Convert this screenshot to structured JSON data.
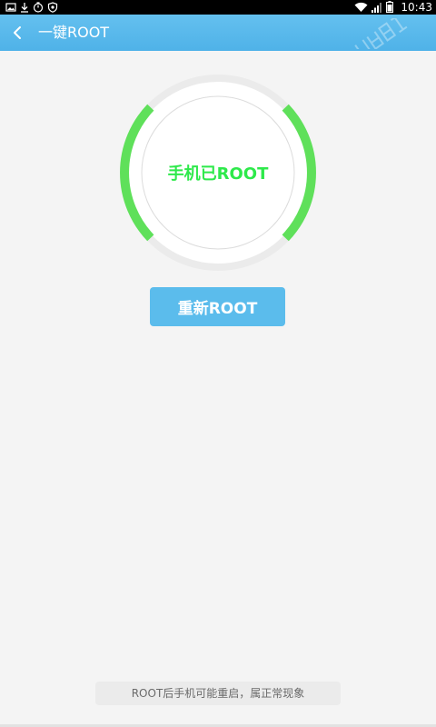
{
  "status_bar": {
    "time": "10:43",
    "left_icons": [
      "image-icon",
      "download-icon",
      "timer-icon",
      "shield-icon"
    ],
    "right_icons": [
      "wifi-icon",
      "signal-icon",
      "battery-icon"
    ]
  },
  "header": {
    "title": "一键ROOT",
    "back_icon": "chevron-left-icon",
    "watermark_icon": "watermark-logo-icon"
  },
  "status": {
    "text": "手机已ROOT",
    "text_color": "#2ee94b",
    "arc_color": "#5fe05a",
    "ring_color": "#ebebeb"
  },
  "actions": {
    "reroot_label": "重新ROOT",
    "button_color": "#5bbcec"
  },
  "footer": {
    "notice": "ROOT后手机可能重启，属正常现象"
  },
  "colors": {
    "header": "#56b6ea",
    "background": "#f4f4f4"
  }
}
